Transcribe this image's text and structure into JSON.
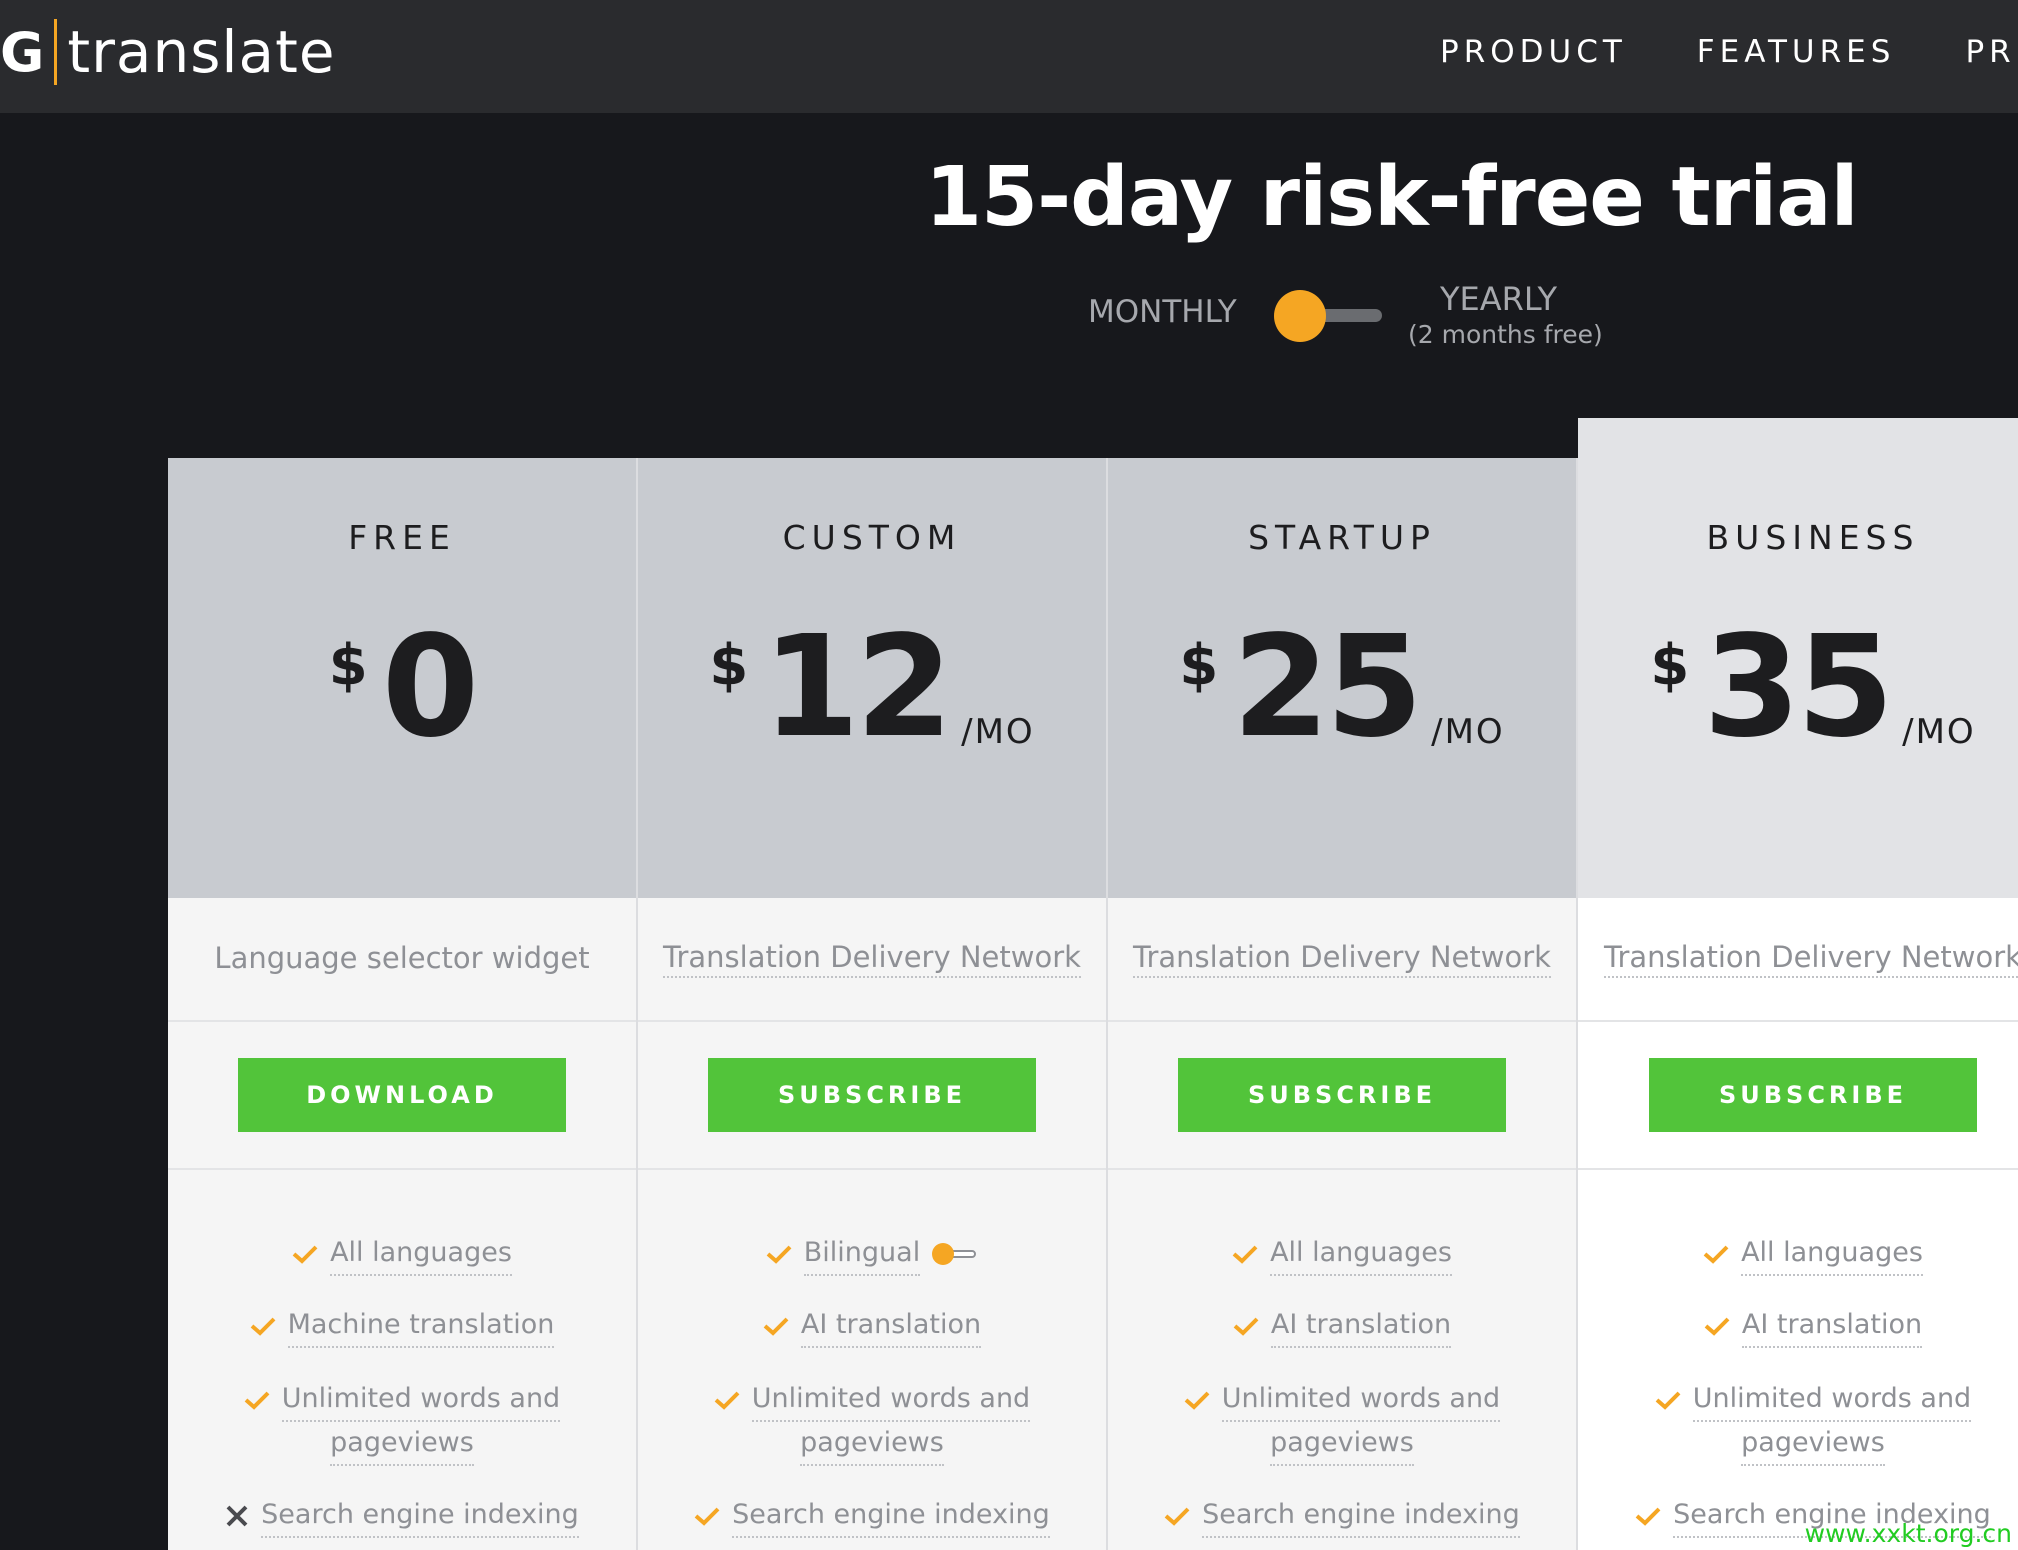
{
  "brand": {
    "mark": "G",
    "name": "translate",
    "accent_color": "#f5a623"
  },
  "nav": {
    "items": [
      "PRODUCT",
      "FEATURES",
      "PRI"
    ]
  },
  "hero": {
    "title": "15-day risk-free trial"
  },
  "billing": {
    "monthly_label": "MONTHLY",
    "yearly_label": "YEARLY",
    "yearly_note": "(2 months free)",
    "selected": "MONTHLY"
  },
  "colors": {
    "button_green": "#52c43a",
    "check_orange": "#f5a623"
  },
  "plans": [
    {
      "name": "FREE",
      "currency": "$",
      "amount": "0",
      "per": "",
      "subtitle": "Language selector widget",
      "cta": "DOWNLOAD",
      "features": [
        {
          "text": "All languages",
          "icon": "check"
        },
        {
          "text": "Machine translation",
          "icon": "check"
        },
        {
          "text": "Unlimited words and",
          "text2": "pageviews",
          "icon": "check"
        },
        {
          "text": "Search engine indexing",
          "icon": "cross"
        }
      ]
    },
    {
      "name": "CUSTOM",
      "currency": "$",
      "amount": "12",
      "per": "/MO",
      "subtitle": "Translation Delivery Network",
      "cta": "SUBSCRIBE",
      "features": [
        {
          "text": "Bilingual",
          "icon": "check",
          "toggle": true
        },
        {
          "text": "AI translation",
          "icon": "check"
        },
        {
          "text": "Unlimited words and",
          "text2": "pageviews",
          "icon": "check"
        },
        {
          "text": "Search engine indexing",
          "icon": "check"
        }
      ]
    },
    {
      "name": "STARTUP",
      "currency": "$",
      "amount": "25",
      "per": "/MO",
      "subtitle": "Translation Delivery Network",
      "cta": "SUBSCRIBE",
      "features": [
        {
          "text": "All languages",
          "icon": "check"
        },
        {
          "text": "AI translation",
          "icon": "check"
        },
        {
          "text": "Unlimited words and",
          "text2": "pageviews",
          "icon": "check"
        },
        {
          "text": "Search engine indexing",
          "icon": "check"
        }
      ]
    },
    {
      "name": "BUSINESS",
      "currency": "$",
      "amount": "35",
      "per": "/MO",
      "subtitle": "Translation Delivery Network",
      "cta": "SUBSCRIBE",
      "features": [
        {
          "text": "All languages",
          "icon": "check"
        },
        {
          "text": "AI translation",
          "icon": "check"
        },
        {
          "text": "Unlimited words and",
          "text2": "pageviews",
          "icon": "check"
        },
        {
          "text": "Search engine indexing",
          "icon": "check"
        }
      ]
    }
  ],
  "watermark": "www.xxkt.org.cn"
}
